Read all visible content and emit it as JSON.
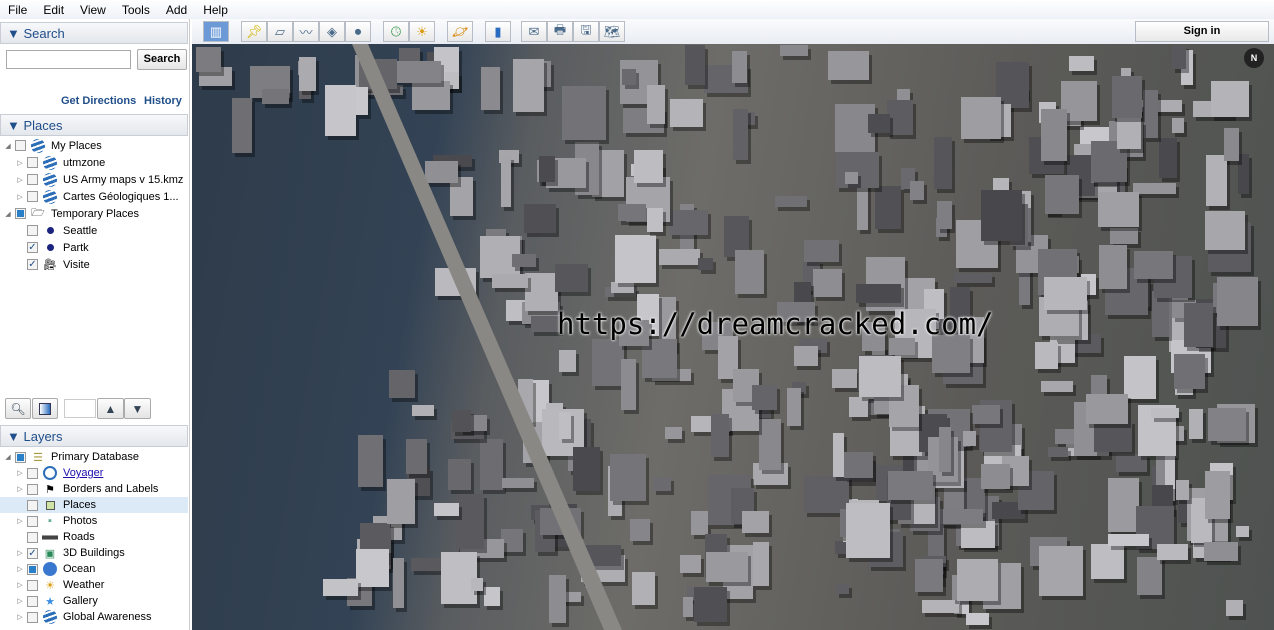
{
  "menu": [
    "File",
    "Edit",
    "View",
    "Tools",
    "Add",
    "Help"
  ],
  "search": {
    "header": "▼ Search",
    "value": "",
    "button": "Search",
    "get_directions": "Get Directions",
    "history": "History"
  },
  "places": {
    "header": "▼ Places",
    "items": [
      {
        "label": "My Places",
        "level": 0,
        "expand": "◢",
        "check": "off",
        "icon": "globe-icon"
      },
      {
        "label": "utmzone",
        "level": 1,
        "expand": "▷",
        "check": "off",
        "icon": "globe-icon"
      },
      {
        "label": "US Army maps v 15.kmz",
        "level": 1,
        "expand": "▷",
        "check": "off",
        "icon": "globe-icon"
      },
      {
        "label": "Cartes Géologiques  1...",
        "level": 1,
        "expand": "▷",
        "check": "off",
        "icon": "globe-icon"
      },
      {
        "label": "Temporary Places",
        "level": 0,
        "expand": "◢",
        "check": "partial",
        "icon": "folder-icon"
      },
      {
        "label": "Seattle",
        "level": 1,
        "expand": "",
        "check": "off",
        "icon": "placemark-icon"
      },
      {
        "label": "Partk",
        "level": 1,
        "expand": "",
        "check": "on",
        "icon": "placemark-icon"
      },
      {
        "label": "Visite",
        "level": 1,
        "expand": "",
        "check": "on",
        "icon": "tour-icon"
      }
    ]
  },
  "layers": {
    "header": "▼ Layers",
    "items": [
      {
        "label": "Primary Database",
        "level": 0,
        "expand": "◢",
        "check": "partial",
        "icon": "database-icon"
      },
      {
        "label": "Voyager",
        "level": 1,
        "expand": "▷",
        "check": "off",
        "icon": "voyager-icon",
        "link": true
      },
      {
        "label": "Borders and Labels",
        "level": 1,
        "expand": "▷",
        "check": "off",
        "icon": "flag-icon"
      },
      {
        "label": "Places",
        "level": 1,
        "expand": "",
        "check": "off",
        "icon": "places-icon",
        "selected": true
      },
      {
        "label": "Photos",
        "level": 1,
        "expand": "▷",
        "check": "off",
        "icon": "photo-icon"
      },
      {
        "label": "Roads",
        "level": 1,
        "expand": "",
        "check": "off",
        "icon": "road-icon"
      },
      {
        "label": "3D Buildings",
        "level": 1,
        "expand": "▷",
        "check": "on",
        "icon": "building-icon"
      },
      {
        "label": "Ocean",
        "level": 1,
        "expand": "▷",
        "check": "partial",
        "icon": "ocean-icon"
      },
      {
        "label": "Weather",
        "level": 1,
        "expand": "▷",
        "check": "off",
        "icon": "sun-icon"
      },
      {
        "label": "Gallery",
        "level": 1,
        "expand": "▷",
        "check": "off",
        "icon": "star-icon"
      },
      {
        "label": "Global Awareness",
        "level": 1,
        "expand": "▷",
        "check": "off",
        "icon": "globe-icon"
      }
    ]
  },
  "toolbar": {
    "sign_in": "Sign in",
    "buttons": [
      "sidebar-toggle",
      "add-placemark",
      "add-polygon",
      "add-path",
      "add-image-overlay",
      "record-tour",
      "historical-imagery",
      "sunlight",
      "planets",
      "ruler",
      "email",
      "print",
      "save-image",
      "view-in-maps"
    ]
  },
  "map": {
    "watermark": "https://dreamcracked.com/",
    "compass": "N"
  }
}
